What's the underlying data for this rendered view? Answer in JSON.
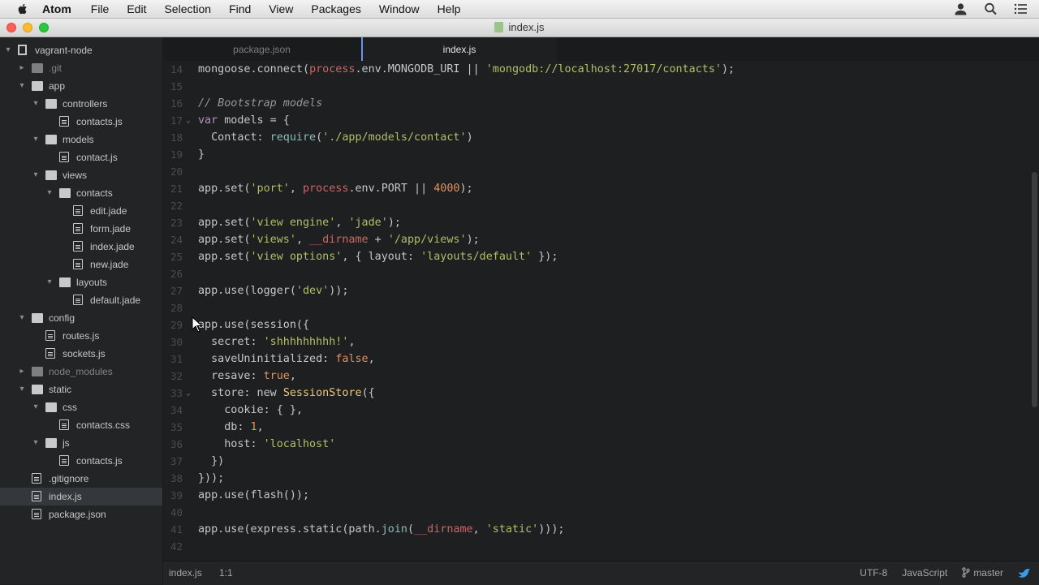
{
  "menubar": {
    "items": [
      "Atom",
      "File",
      "Edit",
      "Selection",
      "Find",
      "View",
      "Packages",
      "Window",
      "Help"
    ],
    "icons": [
      "user-icon",
      "search-icon",
      "list-icon"
    ]
  },
  "window": {
    "title": "index.js"
  },
  "tabs": [
    {
      "label": "package.json",
      "active": false
    },
    {
      "label": "index.js",
      "active": true
    }
  ],
  "tree": [
    {
      "label": "vagrant-node",
      "type": "repo",
      "depth": 0,
      "expanded": true
    },
    {
      "label": ".git",
      "type": "folder",
      "depth": 1,
      "expanded": false,
      "dim": true
    },
    {
      "label": "app",
      "type": "folder",
      "depth": 1,
      "expanded": true
    },
    {
      "label": "controllers",
      "type": "folder",
      "depth": 2,
      "expanded": true
    },
    {
      "label": "contacts.js",
      "type": "file",
      "depth": 3
    },
    {
      "label": "models",
      "type": "folder",
      "depth": 2,
      "expanded": true
    },
    {
      "label": "contact.js",
      "type": "file",
      "depth": 3
    },
    {
      "label": "views",
      "type": "folder",
      "depth": 2,
      "expanded": true
    },
    {
      "label": "contacts",
      "type": "folder",
      "depth": 3,
      "expanded": true
    },
    {
      "label": "edit.jade",
      "type": "file",
      "depth": 4
    },
    {
      "label": "form.jade",
      "type": "file",
      "depth": 4
    },
    {
      "label": "index.jade",
      "type": "file",
      "depth": 4
    },
    {
      "label": "new.jade",
      "type": "file",
      "depth": 4
    },
    {
      "label": "layouts",
      "type": "folder",
      "depth": 3,
      "expanded": true
    },
    {
      "label": "default.jade",
      "type": "file",
      "depth": 4
    },
    {
      "label": "config",
      "type": "folder",
      "depth": 1,
      "expanded": true
    },
    {
      "label": "routes.js",
      "type": "file",
      "depth": 2
    },
    {
      "label": "sockets.js",
      "type": "file",
      "depth": 2
    },
    {
      "label": "node_modules",
      "type": "folder",
      "depth": 1,
      "expanded": false,
      "dim": true
    },
    {
      "label": "static",
      "type": "folder",
      "depth": 1,
      "expanded": true
    },
    {
      "label": "css",
      "type": "folder",
      "depth": 2,
      "expanded": true
    },
    {
      "label": "contacts.css",
      "type": "file",
      "depth": 3
    },
    {
      "label": "js",
      "type": "folder",
      "depth": 2,
      "expanded": true
    },
    {
      "label": "contacts.js",
      "type": "file",
      "depth": 3
    },
    {
      "label": ".gitignore",
      "type": "file",
      "depth": 1
    },
    {
      "label": "index.js",
      "type": "file",
      "depth": 1,
      "selected": true
    },
    {
      "label": "package.json",
      "type": "file",
      "depth": 1
    }
  ],
  "editor": {
    "lines": [
      {
        "n": "14",
        "tokens": [
          [
            "mongoose.connect(",
            "plain"
          ],
          [
            "process",
            "builtin"
          ],
          [
            ".env.MONGODB_URI || ",
            "plain"
          ],
          [
            "'mongodb://localhost:27017/contacts'",
            "str"
          ],
          [
            ");",
            "plain"
          ]
        ]
      },
      {
        "n": "15",
        "tokens": []
      },
      {
        "n": "16",
        "tokens": [
          [
            "// Bootstrap models",
            "comment"
          ]
        ]
      },
      {
        "n": "17",
        "fold": true,
        "tokens": [
          [
            "var",
            "kw"
          ],
          [
            " models = {",
            "plain"
          ]
        ]
      },
      {
        "n": "18",
        "tokens": [
          [
            "  Contact: ",
            "plain"
          ],
          [
            "require",
            "fn2"
          ],
          [
            "(",
            "plain"
          ],
          [
            "'./app/models/contact'",
            "str"
          ],
          [
            ")",
            "plain"
          ]
        ]
      },
      {
        "n": "19",
        "tokens": [
          [
            "}",
            "plain"
          ]
        ]
      },
      {
        "n": "20",
        "tokens": []
      },
      {
        "n": "21",
        "tokens": [
          [
            "app.set(",
            "plain"
          ],
          [
            "'port'",
            "str"
          ],
          [
            ", ",
            "plain"
          ],
          [
            "process",
            "builtin"
          ],
          [
            ".env.PORT || ",
            "plain"
          ],
          [
            "4000",
            "num"
          ],
          [
            ");",
            "plain"
          ]
        ]
      },
      {
        "n": "22",
        "tokens": []
      },
      {
        "n": "23",
        "tokens": [
          [
            "app.set(",
            "plain"
          ],
          [
            "'view engine'",
            "str"
          ],
          [
            ", ",
            "plain"
          ],
          [
            "'jade'",
            "str"
          ],
          [
            ");",
            "plain"
          ]
        ]
      },
      {
        "n": "24",
        "tokens": [
          [
            "app.set(",
            "plain"
          ],
          [
            "'views'",
            "str"
          ],
          [
            ", ",
            "plain"
          ],
          [
            "__dirname",
            "builtin"
          ],
          [
            " + ",
            "plain"
          ],
          [
            "'/app/views'",
            "str"
          ],
          [
            ");",
            "plain"
          ]
        ]
      },
      {
        "n": "25",
        "tokens": [
          [
            "app.set(",
            "plain"
          ],
          [
            "'view options'",
            "str"
          ],
          [
            ", { layout: ",
            "plain"
          ],
          [
            "'layouts/default'",
            "str"
          ],
          [
            " });",
            "plain"
          ]
        ]
      },
      {
        "n": "26",
        "tokens": []
      },
      {
        "n": "27",
        "tokens": [
          [
            "app.use(logger(",
            "plain"
          ],
          [
            "'dev'",
            "str"
          ],
          [
            "));",
            "plain"
          ]
        ]
      },
      {
        "n": "28",
        "tokens": []
      },
      {
        "n": "29",
        "tokens": [
          [
            "app.use(session({",
            "plain"
          ]
        ]
      },
      {
        "n": "30",
        "tokens": [
          [
            "  secret: ",
            "plain"
          ],
          [
            "'shhhhhhhhh!'",
            "str"
          ],
          [
            ",",
            "plain"
          ]
        ]
      },
      {
        "n": "31",
        "tokens": [
          [
            "  saveUninitialized: ",
            "plain"
          ],
          [
            "false",
            "num"
          ],
          [
            ",",
            "plain"
          ]
        ]
      },
      {
        "n": "32",
        "tokens": [
          [
            "  resave: ",
            "plain"
          ],
          [
            "true",
            "num"
          ],
          [
            ",",
            "plain"
          ]
        ]
      },
      {
        "n": "33",
        "fold": true,
        "tokens": [
          [
            "  store: new ",
            "plain"
          ],
          [
            "SessionStore",
            "cls"
          ],
          [
            "({",
            "plain"
          ]
        ]
      },
      {
        "n": "34",
        "tokens": [
          [
            "    cookie: { },",
            "plain"
          ]
        ]
      },
      {
        "n": "35",
        "tokens": [
          [
            "    db: ",
            "plain"
          ],
          [
            "1",
            "num"
          ],
          [
            ",",
            "plain"
          ]
        ]
      },
      {
        "n": "36",
        "tokens": [
          [
            "    host: ",
            "plain"
          ],
          [
            "'localhost'",
            "str"
          ]
        ]
      },
      {
        "n": "37",
        "tokens": [
          [
            "  })",
            "plain"
          ]
        ]
      },
      {
        "n": "38",
        "tokens": [
          [
            "}));",
            "plain"
          ]
        ]
      },
      {
        "n": "39",
        "tokens": [
          [
            "app.use(flash());",
            "plain"
          ]
        ]
      },
      {
        "n": "40",
        "tokens": []
      },
      {
        "n": "41",
        "tokens": [
          [
            "app.use(express.static(path.",
            "plain"
          ],
          [
            "join",
            "fn2"
          ],
          [
            "(",
            "plain"
          ],
          [
            "__dirname",
            "builtin"
          ],
          [
            ", ",
            "plain"
          ],
          [
            "'static'",
            "str"
          ],
          [
            ")));",
            "plain"
          ]
        ]
      },
      {
        "n": "42",
        "tokens": []
      }
    ]
  },
  "status": {
    "file": "index.js",
    "cursor": "1:1",
    "encoding": "UTF-8",
    "grammar": "JavaScript",
    "branch": "master"
  },
  "colors": {
    "accent": "#6494ed",
    "string": "#b5bd68",
    "keyword": "#b294bb",
    "number": "#de935f",
    "builtin": "#cc6666",
    "comment": "#969896"
  }
}
